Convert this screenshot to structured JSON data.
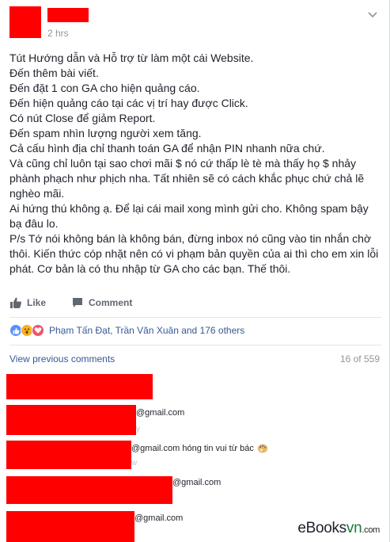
{
  "post": {
    "time": "2 hrs",
    "more": "•••",
    "lines": [
      "Tút Hướng dẫn và Hỗ trợ từ làm một cái Website.",
      "Đến thêm bài viết.",
      "Đến đặt 1 con GA cho hiện quảng cáo.",
      "Đến hiện quảng cáo tại các vị trí hay được Click.",
      "Có nút Close để giảm Report.",
      "Đến spam nhìn lượng người xem tăng.",
      "Cả cấu hình địa chỉ thanh toán GA để nhận PIN nhanh nữa chứ.",
      "Và cũng chỉ luôn tại sao chơi mãi $ nó cứ thấp lè tè mà thấy họ $ nhảy phành phạch như phịch nha. Tất nhiên sẽ có cách khắc phục chứ chả lẽ nghèo mãi.",
      "Ai hứng thú không ạ. Để lại cái mail xong mình gửi cho. Không spam bậy bạ đâu lo.",
      "P/s Tớ nói không bán là không bán, đừng inbox nó cũng vào tin nhắn chờ thôi. Kiến thức cóp nhặt nên có vi phạm bản quyền của ai thì cho em xin lỗi phát. Cơ bản là có thu nhập từ GA cho các bạn. Thế thôi."
    ]
  },
  "actions": {
    "like": "Like",
    "comment": "Comment"
  },
  "reactions": {
    "names": "Phạm Tấn Đạt, Trần Văn Xuân and 176 others",
    "like_color": "#5890ff",
    "wow_color": "#f7b125",
    "love_color": "#f25268"
  },
  "comments_header": {
    "view_previous": "View previous comments",
    "count": "16 of 559"
  },
  "comments": [
    {
      "text": ""
    },
    {
      "text": "@gmail.com",
      "ghost": "y"
    },
    {
      "text": "@gmail.com hóng tin vui từ bác",
      "ghost": "w"
    },
    {
      "text": "@gmail.com"
    },
    {
      "text": "@gmail.com"
    }
  ],
  "watermark": {
    "main": "eBooks",
    "suffix": "vn",
    "tld": ".com"
  },
  "colors": {
    "redaction": "#ff0000",
    "link": "#365899",
    "muted": "#90949c"
  }
}
